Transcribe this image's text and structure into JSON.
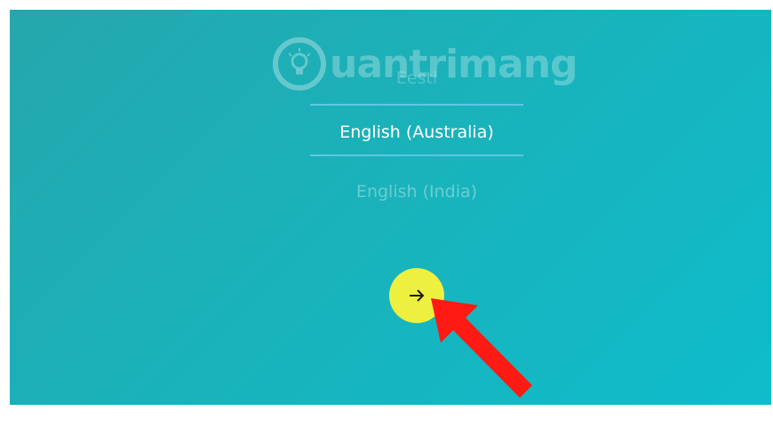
{
  "language_picker": {
    "item_above": "Eesti",
    "selected": "English (Australia)",
    "item_below": "English (India)"
  },
  "watermark": {
    "brand": "uantrimang"
  },
  "next_button": {
    "icon": "arrow-right-icon"
  },
  "colors": {
    "background": "#18b4bd",
    "divider": "#5ec7e6",
    "button": "#eef040",
    "annotation_arrow": "#ff1a14"
  }
}
